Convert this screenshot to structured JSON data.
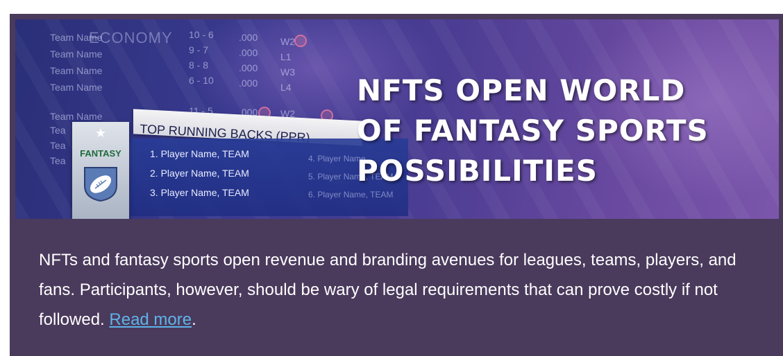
{
  "banner": {
    "headline_lines": [
      "NFTS OPEN WORLD",
      "OF FANTASY SPORTS",
      "POSSIBILITIES"
    ],
    "background": {
      "economy_text": "ECONOMY",
      "standings": [
        {
          "team": "Team Name",
          "record": "10 - 6",
          "pct": ".000",
          "streak": "W2"
        },
        {
          "team": "Team Name",
          "record": "9 - 7",
          "pct": ".000",
          "streak": "L1"
        },
        {
          "team": "Team Name",
          "record": "8 - 8",
          "pct": ".000",
          "streak": "W3"
        },
        {
          "team": "Team Name",
          "record": "6 - 10",
          "pct": ".000",
          "streak": "L4"
        },
        {
          "team": "Team Name",
          "record": "11 - 5",
          "pct": ".000",
          "streak": "W2"
        }
      ],
      "extra_team_rows": [
        "Tea",
        "Tea",
        "Tea"
      ]
    },
    "rb_panel": {
      "title": "TOP RUNNING BACKS (PPR)",
      "players_left": [
        "1. Player Name, TEAM",
        "2. Player Name, TEAM",
        "3. Player Name, TEAM"
      ],
      "players_right": [
        "4. Player Name",
        "5. Player Name, TEAM",
        "6. Player Name, TEAM"
      ]
    },
    "badge": {
      "label": "FANTASY",
      "icon": "football-shield-icon"
    }
  },
  "caption": {
    "text": "NFTs and fantasy sports open revenue and branding avenues for leagues, teams, players, and fans. Participants, however, should be wary of legal requirements that can prove costly if not followed. ",
    "link_label": "Read more",
    "trailing": "."
  },
  "colors": {
    "card_bg": "#4a3a5c",
    "link": "#5fb3e8",
    "headline": "#ffffff"
  }
}
